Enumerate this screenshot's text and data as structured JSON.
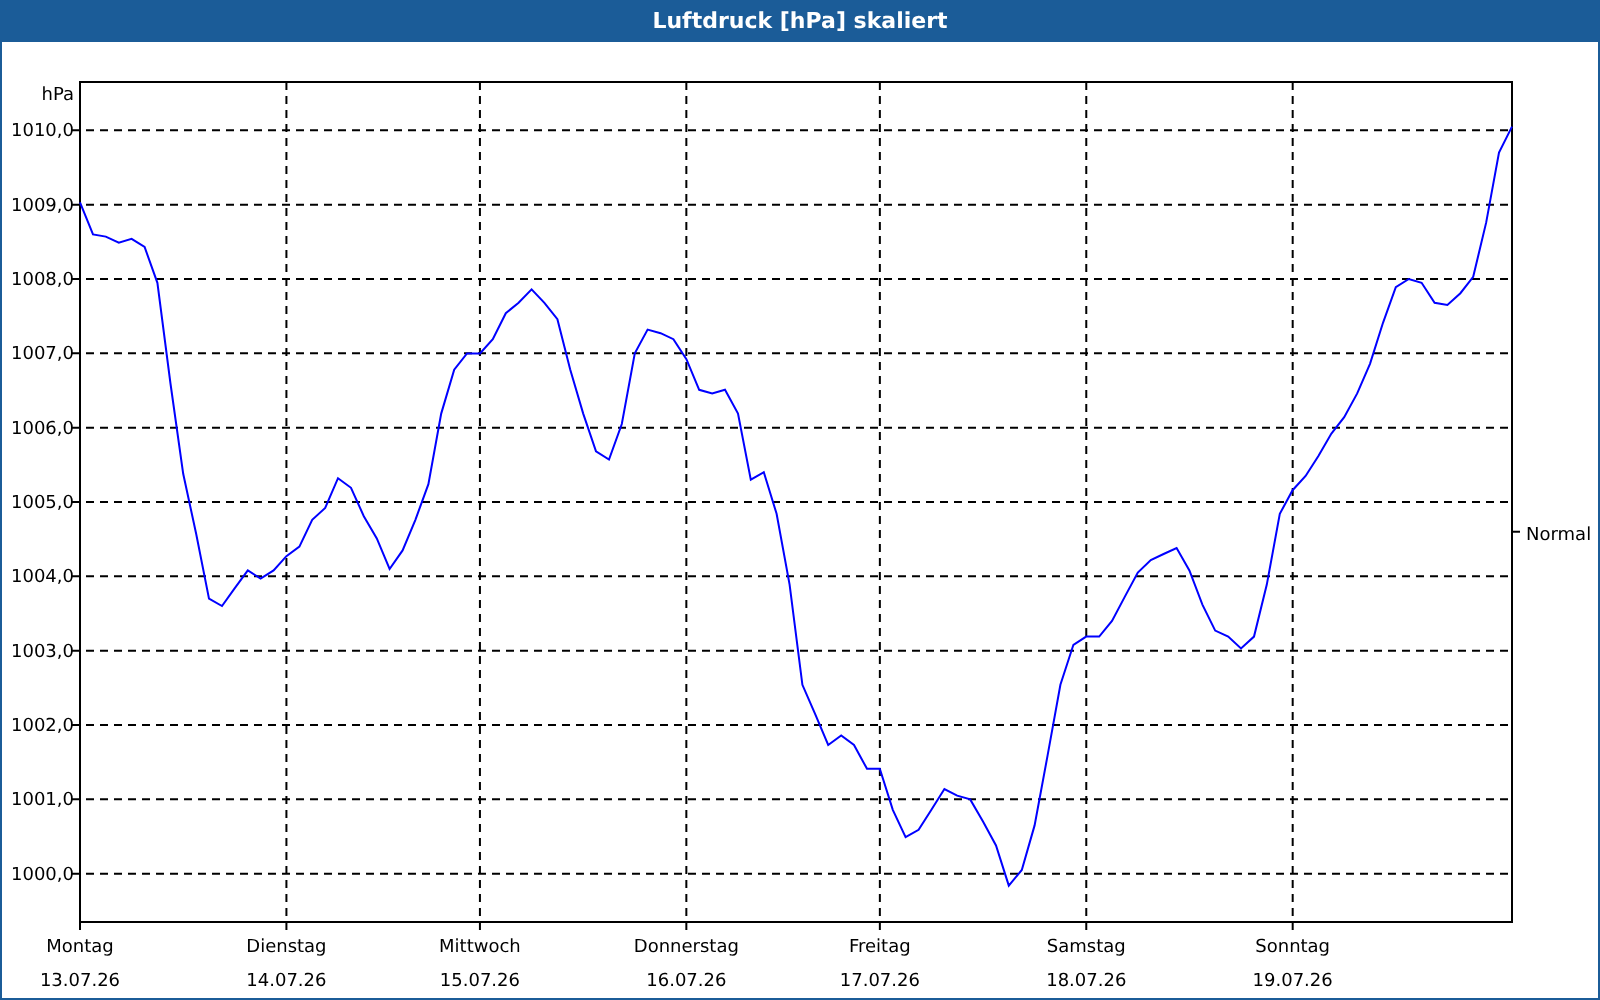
{
  "chart_data": {
    "type": "line",
    "title": "Luftdruck [hPa] skaliert",
    "ylabel": "hPa",
    "ylim": [
      999.35,
      1010.65
    ],
    "categories": [
      "Montag\n13.07.26",
      null,
      null,
      null,
      null,
      null,
      null,
      null,
      null,
      null,
      null,
      null,
      null,
      null,
      null,
      null,
      "Dienstag\n14.07.26",
      null,
      null,
      null,
      null,
      null,
      null,
      null,
      null,
      null,
      null,
      null,
      null,
      null,
      null,
      "Mittwoch\n15.07.26",
      null,
      null,
      null,
      null,
      null,
      null,
      null,
      null,
      null,
      null,
      null,
      null,
      null,
      null,
      null,
      "Donnerstag\n16.07.26",
      null,
      null,
      null,
      null,
      null,
      null,
      null,
      null,
      null,
      null,
      null,
      null,
      null,
      null,
      "Freitag\n17.07.26",
      null,
      null,
      null,
      null,
      null,
      null,
      null,
      null,
      null,
      null,
      null,
      null,
      null,
      null,
      null,
      "Samstag\n18.07.26",
      null,
      null,
      null,
      null,
      null,
      null,
      null,
      null,
      null,
      null,
      null,
      null,
      null,
      null,
      null,
      "Sonntag\n19.07.26",
      null,
      null,
      null,
      null,
      null,
      null,
      null,
      null,
      null,
      null,
      null,
      null,
      null,
      null,
      null,
      null,
      null
    ],
    "yticks": [
      {
        "value": 1000,
        "label": "1000,0"
      },
      {
        "value": 1001,
        "label": "1001,0"
      },
      {
        "value": 1002,
        "label": "1002,0"
      },
      {
        "value": 1003,
        "label": "1003,0"
      },
      {
        "value": 1004,
        "label": "1004,0"
      },
      {
        "value": 1005,
        "label": "1005,0"
      },
      {
        "value": 1006,
        "label": "1006,0"
      },
      {
        "value": 1007,
        "label": "1007,0"
      },
      {
        "value": 1008,
        "label": "1008,0"
      },
      {
        "value": 1009,
        "label": "1009,0"
      },
      {
        "value": 1010,
        "label": "1010,0"
      }
    ],
    "series": [
      {
        "color": "#0000ff",
        "values": [
          1009.03,
          1008.6,
          1008.57,
          1008.49,
          1008.54,
          1008.43,
          1007.95,
          1006.6,
          1005.38,
          1004.57,
          1003.7,
          1003.6,
          1003.84,
          1004.08,
          1003.97,
          1004.08,
          1004.27,
          1004.4,
          1004.76,
          1004.92,
          1005.32,
          1005.19,
          1004.81,
          1004.51,
          1004.1,
          1004.35,
          1004.76,
          1005.24,
          1006.19,
          1006.78,
          1007.0,
          1007.0,
          1007.19,
          1007.54,
          1007.68,
          1007.86,
          1007.68,
          1007.46,
          1006.78,
          1006.19,
          1005.68,
          1005.57,
          1006.05,
          1007.0,
          1007.32,
          1007.27,
          1007.19,
          1006.92,
          1006.51,
          1006.46,
          1006.51,
          1006.19,
          1005.3,
          1005.4,
          1004.84,
          1003.89,
          1002.54,
          1002.14,
          1001.73,
          1001.86,
          1001.73,
          1001.41,
          1001.41,
          1000.86,
          1000.49,
          1000.59,
          1000.86,
          1001.14,
          1001.05,
          1001.0,
          1000.7,
          1000.38,
          999.84,
          1000.05,
          1000.65,
          1001.59,
          1002.54,
          1003.08,
          1003.19,
          1003.19,
          1003.4,
          1003.73,
          1004.05,
          1004.22,
          1004.3,
          1004.38,
          1004.08,
          1003.62,
          1003.27,
          1003.19,
          1003.03,
          1003.19,
          1003.89,
          1004.84,
          1005.16,
          1005.35,
          1005.62,
          1005.92,
          1006.14,
          1006.46,
          1006.86,
          1007.41,
          1007.89,
          1008.0,
          1007.95,
          1007.68,
          1007.65,
          1007.81,
          1008.03,
          1008.76,
          1009.7,
          1010.05
        ]
      }
    ],
    "grid": true,
    "ref_lines": [
      {
        "axis": "y",
        "value": 1004.6,
        "label": "Normal"
      }
    ]
  }
}
